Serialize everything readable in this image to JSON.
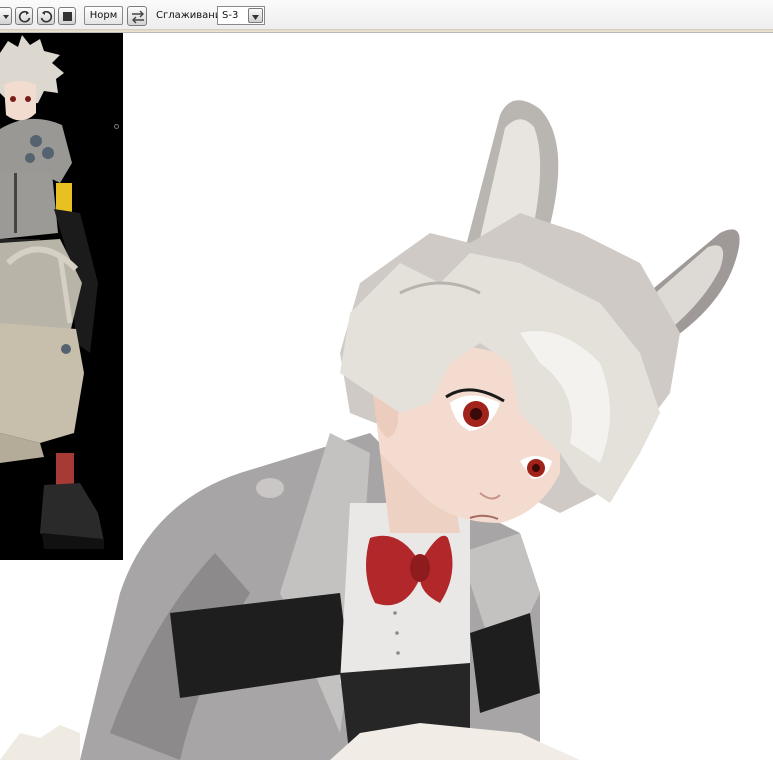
{
  "toolbar": {
    "normal_button_label": "Норм",
    "smoothing_label": "Сглаживание",
    "smoothing_value": "S-3"
  },
  "icons": {
    "dropdown": "chevron-down-icon",
    "rotate_left": "rotate-left-icon",
    "rotate_right": "rotate-right-icon",
    "stop": "square-icon",
    "flip": "flip-icon"
  },
  "colors": {
    "canvas_bg": "#ffffff",
    "reference_bg": "#000000",
    "hair": "#e4e0da",
    "coat": "#a8a5a6",
    "stripe": "#1e1e1e",
    "bow": "#b2272a",
    "eye": "#a1231b"
  }
}
